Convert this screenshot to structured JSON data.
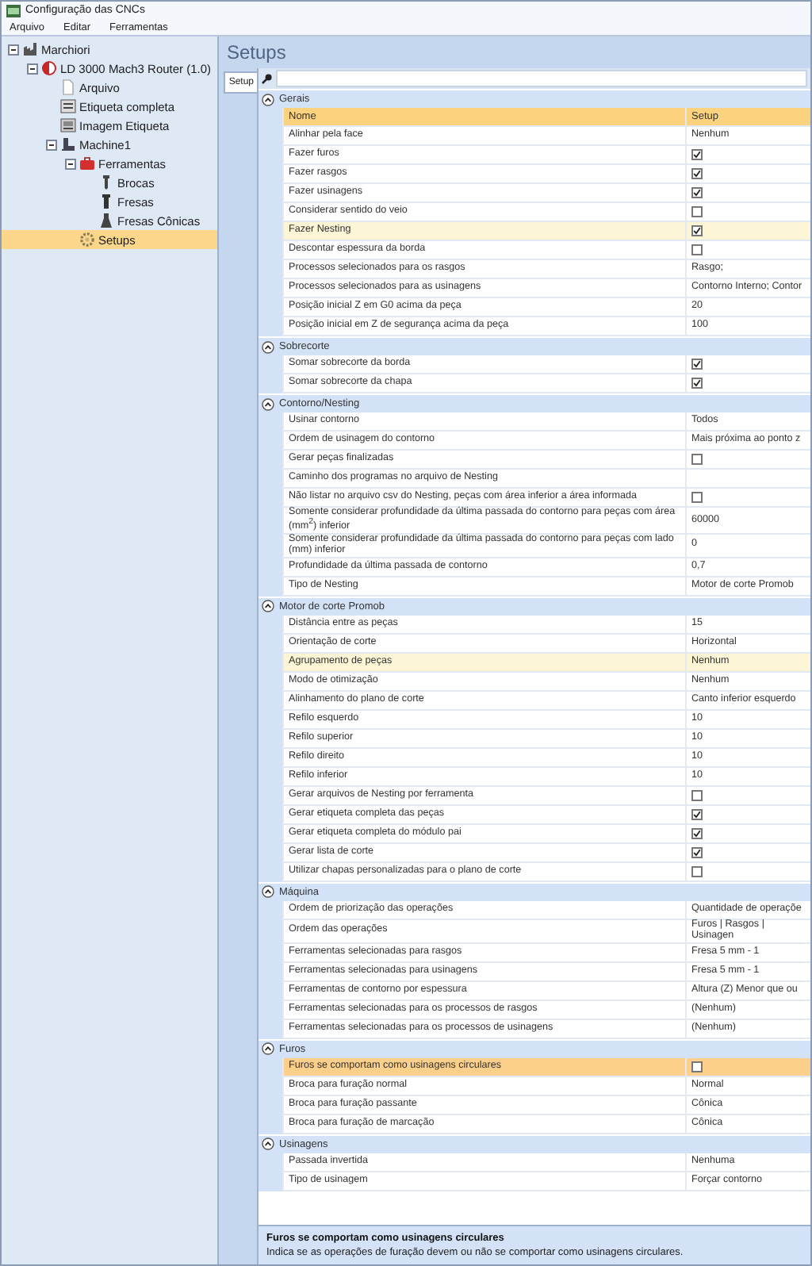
{
  "window": {
    "title": "Configuração das CNCs"
  },
  "menu": [
    "Arquivo",
    "Editar",
    "Ferramentas"
  ],
  "tree": [
    {
      "label": "Marchiori",
      "kind": "factory",
      "selected": false,
      "expanded": true,
      "children": [
        {
          "label": "LD 3000 Mach3 Router (1.0)",
          "kind": "router",
          "selected": false,
          "expanded": true,
          "children": [
            {
              "label": "Arquivo",
              "kind": "file",
              "selected": false
            },
            {
              "label": "Etiqueta completa",
              "kind": "label",
              "selected": false
            },
            {
              "label": "Imagem Etiqueta",
              "kind": "image",
              "selected": false
            },
            {
              "label": "Machine1",
              "kind": "machine",
              "selected": false,
              "expanded": true,
              "children": [
                {
                  "label": "Ferramentas",
                  "kind": "toolbox",
                  "selected": false,
                  "expanded": true,
                  "children": [
                    {
                      "label": "Brocas",
                      "kind": "drill",
                      "selected": false
                    },
                    {
                      "label": "Fresas",
                      "kind": "mill",
                      "selected": false
                    },
                    {
                      "label": "Fresas Cônicas",
                      "kind": "cone",
                      "selected": false
                    }
                  ]
                },
                {
                  "label": "Setups",
                  "kind": "gear",
                  "selected": true
                }
              ]
            }
          ]
        }
      ]
    }
  ],
  "page_title": "Setups",
  "tabs": [
    {
      "label": "Setup",
      "selected": true
    }
  ],
  "grid": {
    "columns": [
      "Nome",
      "Setup"
    ],
    "categories": [
      {
        "title": "Gerais",
        "expanded": true,
        "rows": [
          {
            "name": "Alinhar pela face",
            "kind": "text",
            "value": "Nenhum",
            "selected": false,
            "hovered": false
          },
          {
            "name": "Fazer furos",
            "kind": "check",
            "checked": true,
            "selected": false,
            "hovered": false
          },
          {
            "name": "Fazer rasgos",
            "kind": "check",
            "checked": true,
            "selected": false,
            "hovered": false
          },
          {
            "name": "Fazer usinagens",
            "kind": "check",
            "checked": true,
            "selected": false,
            "hovered": false
          },
          {
            "name": "Considerar sentido do veio",
            "kind": "check",
            "checked": false,
            "selected": false,
            "hovered": false
          },
          {
            "name": "Fazer Nesting",
            "kind": "check",
            "checked": true,
            "selected": false,
            "hovered": true
          },
          {
            "name": "Descontar espessura da borda",
            "kind": "check",
            "checked": false,
            "selected": false,
            "hovered": false
          },
          {
            "name": "Processos selecionados para os rasgos",
            "kind": "text",
            "value": "Rasgo;",
            "selected": false,
            "hovered": false
          },
          {
            "name": "Processos selecionados para as usinagens",
            "kind": "text",
            "value": "Contorno Interno; Contor",
            "selected": false,
            "hovered": false
          },
          {
            "name": "Posição inicial Z em G0 acima da peça",
            "kind": "text",
            "value": "20",
            "selected": false,
            "hovered": false
          },
          {
            "name": "Posição inicial em Z de segurança acima da peça",
            "kind": "text",
            "value": "100",
            "selected": false,
            "hovered": false
          }
        ]
      },
      {
        "title": "Sobrecorte",
        "expanded": true,
        "rows": [
          {
            "name": "Somar sobrecorte da borda",
            "kind": "check",
            "checked": true,
            "selected": false,
            "hovered": false
          },
          {
            "name": "Somar sobrecorte da chapa",
            "kind": "check",
            "checked": true,
            "selected": false,
            "hovered": false
          }
        ]
      },
      {
        "title": "Contorno/Nesting",
        "expanded": true,
        "rows": [
          {
            "name": "Usinar contorno",
            "kind": "text",
            "value": "Todos",
            "selected": false,
            "hovered": false
          },
          {
            "name": "Ordem de usinagem do contorno",
            "kind": "text",
            "value": "Mais próxima ao ponto z",
            "selected": false,
            "hovered": false
          },
          {
            "name": "Gerar peças finalizadas",
            "kind": "check",
            "checked": false,
            "selected": false,
            "hovered": false
          },
          {
            "name": "Caminho dos programas no arquivo de Nesting",
            "kind": "text",
            "selected": false,
            "hovered": false
          },
          {
            "name": "Não listar no arquivo csv do Nesting, peças com área inferior a área informada",
            "kind": "check",
            "checked": false,
            "selected": false,
            "hovered": false
          },
          {
            "name": "Somente considerar profundidade da última passada do contorno para peças com área (mm$^{2}$) inferior",
            "kind": "text",
            "value": "60000",
            "selected": false,
            "hovered": false
          },
          {
            "name": "Somente considerar profundidade da última passada do contorno para peças com lado (mm) inferior",
            "kind": "text",
            "value": "0",
            "selected": false,
            "hovered": false
          },
          {
            "name": "Profundidade da última passada de contorno",
            "kind": "text",
            "value": "0,7",
            "selected": false,
            "hovered": false
          },
          {
            "name": "Tipo de Nesting",
            "kind": "text",
            "value": "Motor de corte Promob",
            "selected": false,
            "hovered": false
          }
        ]
      },
      {
        "title": "Motor de corte Promob",
        "expanded": true,
        "rows": [
          {
            "name": "Distância entre as peças",
            "kind": "text",
            "value": "15",
            "selected": false,
            "hovered": false
          },
          {
            "name": "Orientação de corte",
            "kind": "text",
            "value": "Horizontal",
            "selected": false,
            "hovered": false
          },
          {
            "name": "Agrupamento de peças",
            "kind": "text",
            "value": "Nenhum",
            "selected": false,
            "hovered": true
          },
          {
            "name": "Modo de otimização",
            "kind": "text",
            "value": "Nenhum",
            "selected": false,
            "hovered": false
          },
          {
            "name": "Alinhamento do plano de corte",
            "kind": "text",
            "value": "Canto inferior esquerdo",
            "selected": false,
            "hovered": false
          },
          {
            "name": "Refilo esquerdo",
            "kind": "text",
            "value": "10",
            "selected": false,
            "hovered": false
          },
          {
            "name": "Refilo superior",
            "kind": "text",
            "value": "10",
            "selected": false,
            "hovered": false
          },
          {
            "name": "Refilo direito",
            "kind": "text",
            "value": "10",
            "selected": false,
            "hovered": false
          },
          {
            "name": "Refilo inferior",
            "kind": "text",
            "value": "10",
            "selected": false,
            "hovered": false
          },
          {
            "name": "Gerar arquivos de Nesting por ferramenta",
            "kind": "check",
            "checked": false,
            "selected": false,
            "hovered": false
          },
          {
            "name": "Gerar etiqueta completa das peças",
            "kind": "check",
            "checked": true,
            "selected": false,
            "hovered": false
          },
          {
            "name": "Gerar etiqueta completa do módulo pai",
            "kind": "check",
            "checked": true,
            "selected": false,
            "hovered": false
          },
          {
            "name": "Gerar lista de corte",
            "kind": "check",
            "checked": true,
            "selected": false,
            "hovered": false
          },
          {
            "name": "Utilizar chapas personalizadas para o plano de corte",
            "kind": "check",
            "checked": false,
            "selected": false,
            "hovered": false
          }
        ]
      },
      {
        "title": "Máquina",
        "expanded": true,
        "rows": [
          {
            "name": "Ordem de priorização das operações",
            "kind": "text",
            "value": "Quantidade de operaçõe",
            "selected": false,
            "hovered": false
          },
          {
            "name": "Ordem das operações",
            "kind": "text",
            "value": "Furos | Rasgos | Usinagen",
            "selected": false,
            "hovered": false
          },
          {
            "name": "Ferramentas selecionadas para rasgos",
            "kind": "text",
            "value": "Fresa 5 mm - 1",
            "selected": false,
            "hovered": false
          },
          {
            "name": "Ferramentas selecionadas para usinagens",
            "kind": "text",
            "value": "Fresa 5 mm - 1",
            "selected": false,
            "hovered": false
          },
          {
            "name": "Ferramentas de contorno por espessura",
            "kind": "text",
            "value": "Altura (Z) Menor que ou",
            "selected": false,
            "hovered": false
          },
          {
            "name": "Ferramentas selecionadas para os processos de rasgos",
            "kind": "text",
            "value": "(Nenhum)",
            "selected": false,
            "hovered": false
          },
          {
            "name": "Ferramentas selecionadas para os processos de usinagens",
            "kind": "text",
            "value": "(Nenhum)",
            "selected": false,
            "hovered": false
          }
        ]
      },
      {
        "title": "Furos",
        "expanded": true,
        "rows": [
          {
            "name": "Furos se comportam como usinagens circulares",
            "kind": "check",
            "checked": false,
            "selected": true,
            "hovered": false
          },
          {
            "name": "Broca para furação normal",
            "kind": "text",
            "value": "Normal",
            "selected": false,
            "hovered": false
          },
          {
            "name": "Broca para furação passante",
            "kind": "text",
            "value": "Cônica",
            "selected": false,
            "hovered": false
          },
          {
            "name": "Broca para furação de marcação",
            "kind": "text",
            "value": "Cônica",
            "selected": false,
            "hovered": false
          }
        ]
      },
      {
        "title": "Usinagens",
        "expanded": true,
        "rows": [
          {
            "name": "Passada invertida",
            "kind": "text",
            "value": "Nenhuma",
            "selected": false,
            "hovered": false
          },
          {
            "name": "Tipo de usinagem",
            "kind": "text",
            "value": "Forçar contorno",
            "selected": false,
            "hovered": false
          }
        ]
      }
    ]
  },
  "description": {
    "title": "Furos se comportam como usinagens circulares",
    "text": "Indica se as operações de furação devem ou não se comportar como usinagens circulares."
  }
}
